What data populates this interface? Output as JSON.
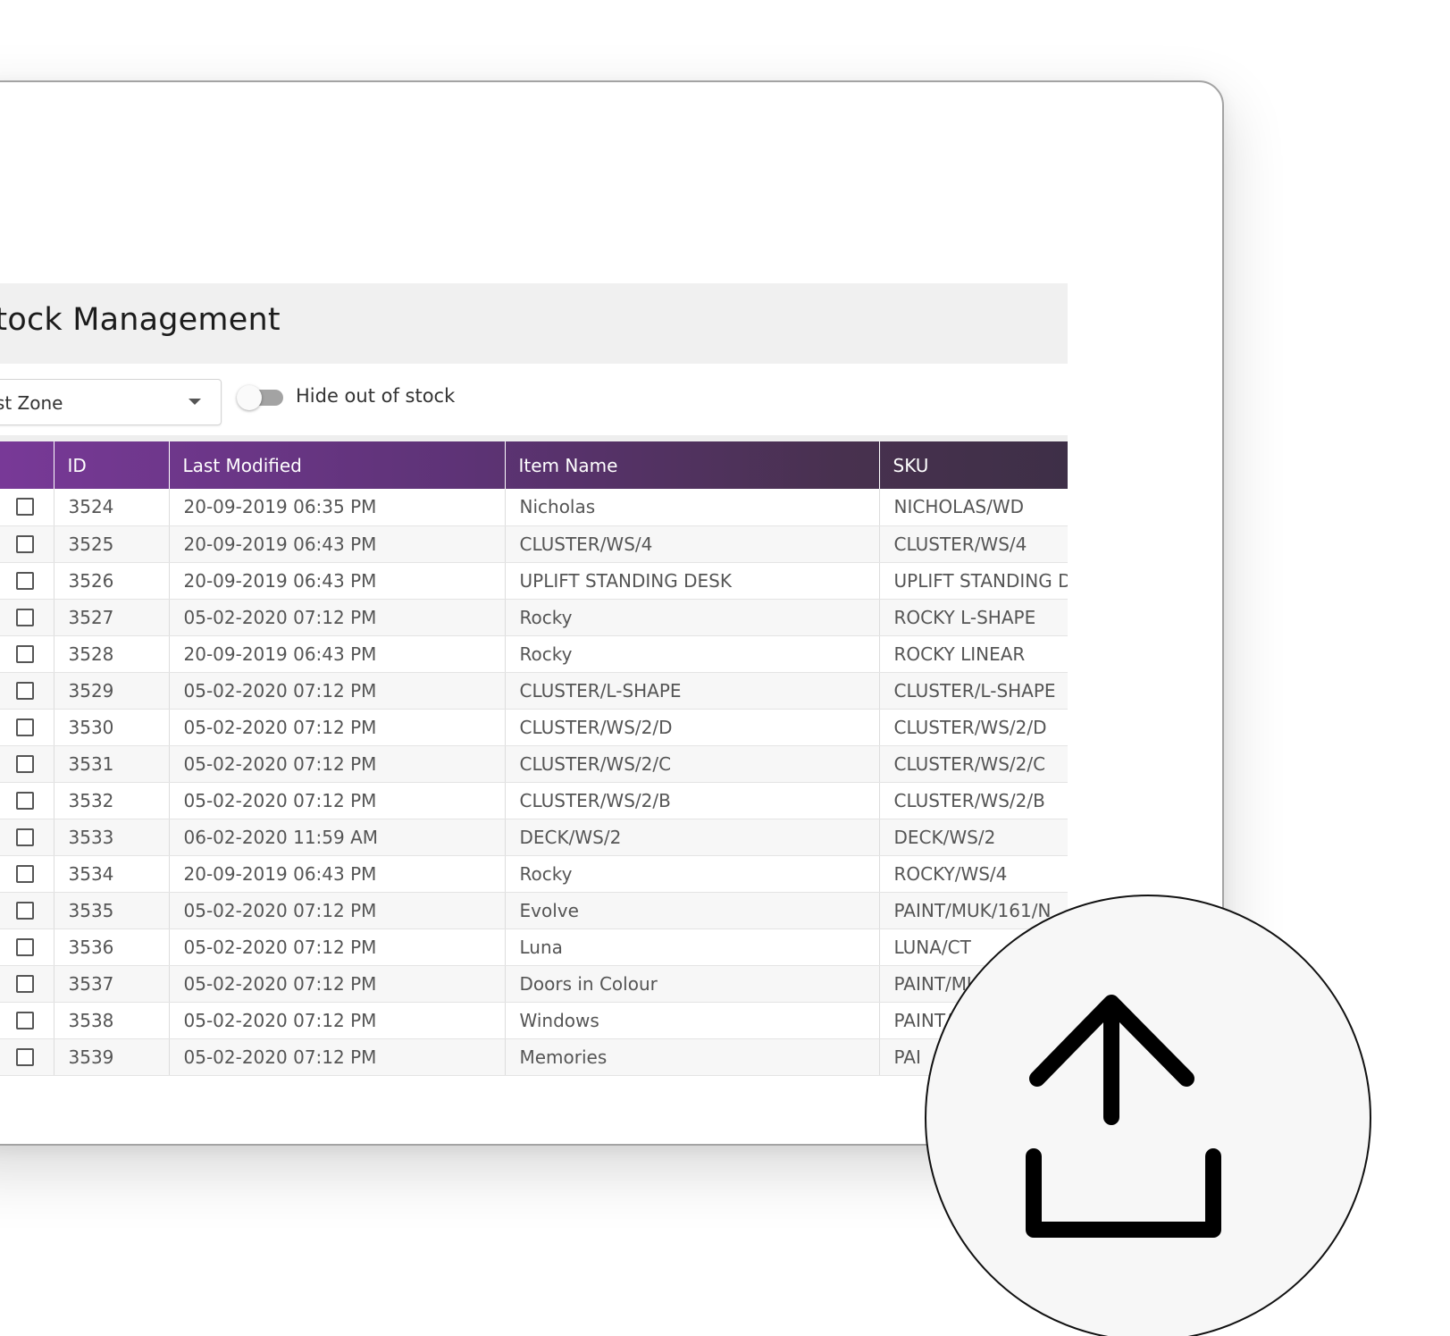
{
  "header": {
    "title": "Stock Management"
  },
  "filters": {
    "zone_value": "West Zone",
    "hide_out_of_stock_label": "Hide out of stock",
    "hide_out_of_stock_on": false
  },
  "table": {
    "columns": [
      "ID",
      "Last Modified",
      "Item Name",
      "SKU"
    ],
    "rows": [
      {
        "id": "3524",
        "modified": "20-09-2019 06:35 PM",
        "name": "Nicholas",
        "sku": "NICHOLAS/WD"
      },
      {
        "id": "3525",
        "modified": "20-09-2019 06:43 PM",
        "name": "CLUSTER/WS/4",
        "sku": "CLUSTER/WS/4"
      },
      {
        "id": "3526",
        "modified": "20-09-2019 06:43 PM",
        "name": "UPLIFT STANDING DESK",
        "sku": "UPLIFT STANDING DESK"
      },
      {
        "id": "3527",
        "modified": "05-02-2020 07:12 PM",
        "name": "Rocky",
        "sku": "ROCKY L-SHAPE"
      },
      {
        "id": "3528",
        "modified": "20-09-2019 06:43 PM",
        "name": "Rocky",
        "sku": "ROCKY LINEAR"
      },
      {
        "id": "3529",
        "modified": "05-02-2020 07:12 PM",
        "name": "CLUSTER/L-SHAPE",
        "sku": "CLUSTER/L-SHAPE"
      },
      {
        "id": "3530",
        "modified": "05-02-2020 07:12 PM",
        "name": "CLUSTER/WS/2/D",
        "sku": "CLUSTER/WS/2/D"
      },
      {
        "id": "3531",
        "modified": "05-02-2020 07:12 PM",
        "name": "CLUSTER/WS/2/C",
        "sku": "CLUSTER/WS/2/C"
      },
      {
        "id": "3532",
        "modified": "05-02-2020 07:12 PM",
        "name": "CLUSTER/WS/2/B",
        "sku": "CLUSTER/WS/2/B"
      },
      {
        "id": "3533",
        "modified": "06-02-2020 11:59 AM",
        "name": "DECK/WS/2",
        "sku": "DECK/WS/2"
      },
      {
        "id": "3534",
        "modified": "20-09-2019 06:43 PM",
        "name": "Rocky",
        "sku": "ROCKY/WS/4"
      },
      {
        "id": "3535",
        "modified": "05-02-2020 07:12 PM",
        "name": "Evolve",
        "sku": "PAINT/MUK/161/N"
      },
      {
        "id": "3536",
        "modified": "05-02-2020 07:12 PM",
        "name": "Luna",
        "sku": "LUNA/CT"
      },
      {
        "id": "3537",
        "modified": "05-02-2020 07:12 PM",
        "name": "Doors in Colour",
        "sku": "PAINT/MUK/16"
      },
      {
        "id": "3538",
        "modified": "05-02-2020 07:12 PM",
        "name": "Windows",
        "sku": "PAINT/M"
      },
      {
        "id": "3539",
        "modified": "05-02-2020 07:12 PM",
        "name": "Memories",
        "sku": "PAI"
      }
    ]
  },
  "icons": {
    "zone_dropdown": "caret-down-icon",
    "overlay": "upload-icon"
  },
  "colors": {
    "header_gradient_start": "#7b3a9b",
    "header_gradient_end": "#3e2f47",
    "title_bar": "#f0f0f0",
    "toggle_track": "#a3a3a3"
  }
}
